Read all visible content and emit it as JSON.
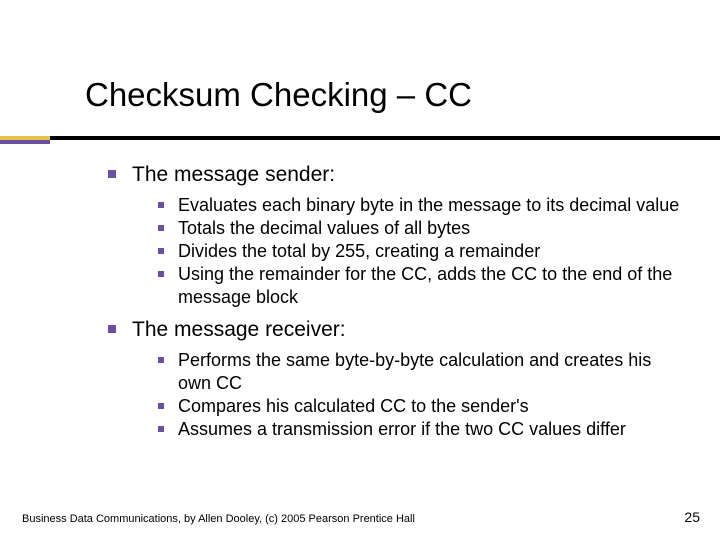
{
  "title": "Checksum Checking – CC",
  "sections": [
    {
      "heading": "The message sender:",
      "items": [
        "Evaluates each binary byte in the message to its decimal value",
        "Totals the decimal values of all bytes",
        "Divides the total by 255, creating a remainder",
        "Using the remainder for the CC, adds the CC to the end of the message block"
      ]
    },
    {
      "heading": "The message receiver:",
      "items": [
        "Performs the same byte-by-byte calculation and creates his own CC",
        "Compares his calculated CC to the sender's",
        "Assumes a transmission error if the two CC values differ"
      ]
    }
  ],
  "footer": "Business Data Communications, by Allen Dooley, (c) 2005 Pearson Prentice Hall",
  "page_number": "25"
}
